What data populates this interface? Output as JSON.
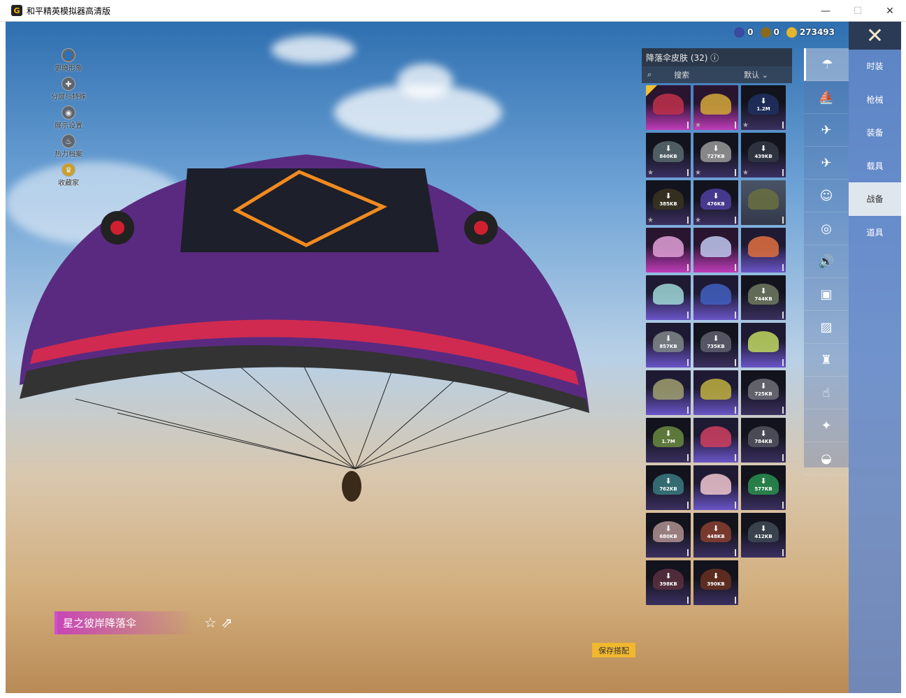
{
  "window": {
    "title": "和平精英模拟器高清版",
    "minimize": "—",
    "maximize": "☐",
    "close": "✕"
  },
  "side_menu": [
    {
      "label": "更换形象",
      "icon": "person-icon",
      "glyph": "👤"
    },
    {
      "label": "分屏与特殊",
      "icon": "puzzle-icon",
      "glyph": "✚"
    },
    {
      "label": "展示设置",
      "icon": "eye-icon",
      "glyph": "◉"
    },
    {
      "label": "热力档案",
      "icon": "flame-icon",
      "glyph": "♨"
    },
    {
      "label": "收藏家",
      "icon": "badge-icon",
      "glyph": "♛"
    }
  ],
  "currency": [
    {
      "value": "0",
      "color": "#3a4aa0"
    },
    {
      "value": "0",
      "color": "#8a6a20"
    },
    {
      "value": "273493",
      "color": "#e6b62a"
    }
  ],
  "panel": {
    "title": "降落伞皮肤 (32) ⓘ",
    "search_placeholder": "搜索",
    "sort": "默认"
  },
  "items": [
    {
      "tier": "legendary",
      "size": "",
      "star": false,
      "equipped": true,
      "color": "#c0304a"
    },
    {
      "tier": "legendary",
      "size": "",
      "star": true,
      "color": "#d4a838"
    },
    {
      "tier": "plain",
      "size": "1.2M",
      "star": true,
      "color": "#203060"
    },
    {
      "tier": "plain",
      "size": "840KB",
      "star": true,
      "color": "#5a6a70"
    },
    {
      "tier": "plain",
      "size": "727KB",
      "star": true,
      "color": "#9a9a9a"
    },
    {
      "tier": "plain",
      "size": "439KB",
      "star": true,
      "color": "#333844"
    },
    {
      "tier": "plain",
      "size": "385KB",
      "star": true,
      "color": "#3a3420"
    },
    {
      "tier": "plain",
      "size": "476KB",
      "star": true,
      "color": "#5040a0"
    },
    {
      "tier": "scenic",
      "size": "",
      "star": false,
      "color": "#6a7040"
    },
    {
      "tier": "legendary",
      "size": "",
      "star": false,
      "color": "#e0a0d8"
    },
    {
      "tier": "legendary",
      "size": "",
      "star": false,
      "color": "#c0c8f0"
    },
    {
      "tier": "epic",
      "size": "",
      "star": false,
      "color": "#e07040"
    },
    {
      "tier": "epic",
      "size": "",
      "star": false,
      "color": "#a0d8d8"
    },
    {
      "tier": "epic",
      "size": "",
      "star": false,
      "color": "#4060c0"
    },
    {
      "tier": "plain",
      "size": "744KB",
      "star": false,
      "color": "#707a60"
    },
    {
      "tier": "epic",
      "size": "857KB",
      "star": false,
      "color": "#808888"
    },
    {
      "tier": "plain",
      "size": "735KB",
      "star": false,
      "color": "#606070"
    },
    {
      "tier": "epic",
      "size": "",
      "star": false,
      "color": "#c0d860"
    },
    {
      "tier": "epic",
      "size": "",
      "star": false,
      "color": "#a0a070"
    },
    {
      "tier": "epic",
      "size": "",
      "star": false,
      "color": "#c0b040"
    },
    {
      "tier": "plain",
      "size": "725KB",
      "star": false,
      "color": "#707078"
    },
    {
      "tier": "plain",
      "size": "1.7M",
      "star": false,
      "color": "#6a8a40"
    },
    {
      "tier": "epic",
      "size": "",
      "star": false,
      "color": "#d04060"
    },
    {
      "tier": "plain",
      "size": "784KB",
      "star": false,
      "color": "#555560"
    },
    {
      "tier": "plain",
      "size": "762KB",
      "star": false,
      "color": "#3a7a80"
    },
    {
      "tier": "epic",
      "size": "",
      "star": false,
      "color": "#f0c8d0"
    },
    {
      "tier": "plain",
      "size": "577KB",
      "star": false,
      "color": "#2a9050"
    },
    {
      "tier": "plain",
      "size": "680KB",
      "star": false,
      "color": "#b09090"
    },
    {
      "tier": "plain",
      "size": "448KB",
      "star": false,
      "color": "#8a4030"
    },
    {
      "tier": "plain",
      "size": "412KB",
      "star": false,
      "color": "#404a55"
    },
    {
      "tier": "plain",
      "size": "398KB",
      "star": false,
      "color": "#5a3040"
    },
    {
      "tier": "plain",
      "size": "390KB",
      "star": false,
      "color": "#6a3020"
    }
  ],
  "category_icons": [
    "parachute-icon",
    "backpack-icon",
    "drone-icon",
    "plane-icon",
    "emote-icon",
    "pet-icon",
    "speaker-icon",
    "tag-icon",
    "picture-icon",
    "extinguisher-icon",
    "tap-icon",
    "wand-icon",
    "ufo-icon"
  ],
  "category_glyphs": [
    "☂",
    "⛵",
    "✈",
    "✈",
    "☺",
    "◎",
    "🔊",
    "▣",
    "▨",
    "♜",
    "☝",
    "✦",
    "◒"
  ],
  "tabs": [
    {
      "label": "时装"
    },
    {
      "label": "枪械"
    },
    {
      "label": "装备"
    },
    {
      "label": "载具"
    },
    {
      "label": "战备",
      "active": true
    },
    {
      "label": "道具"
    }
  ],
  "selected_item": {
    "name": "星之彼岸降落伞"
  },
  "buttons": {
    "save": "保存搭配",
    "close": "✕",
    "favorite": "☆",
    "share": "⇗"
  },
  "download_glyph": "⬇"
}
